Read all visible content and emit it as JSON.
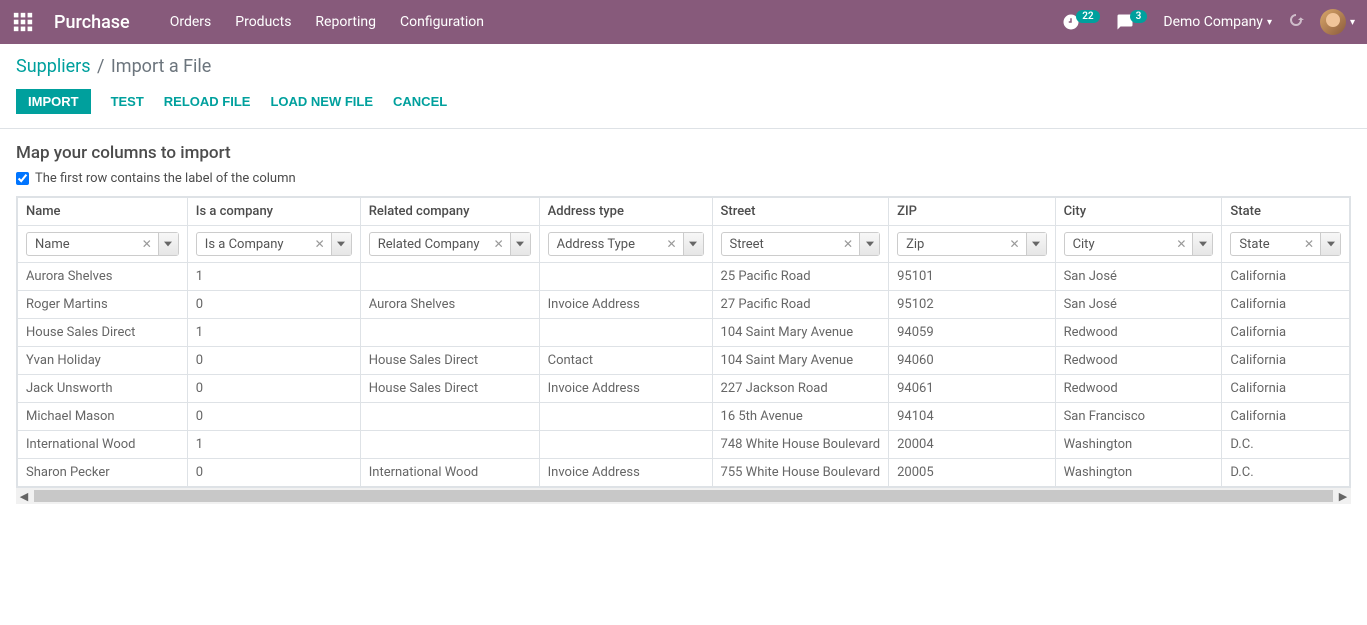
{
  "navbar": {
    "app_title": "Purchase",
    "menu": [
      "Orders",
      "Products",
      "Reporting",
      "Configuration"
    ],
    "activities_count": "22",
    "messages_count": "3",
    "company": "Demo Company"
  },
  "breadcrumb": {
    "root": "Suppliers",
    "current": "Import a File"
  },
  "actions": {
    "import": "IMPORT",
    "test": "TEST",
    "reload": "RELOAD FILE",
    "load_new": "LOAD NEW FILE",
    "cancel": "CANCEL"
  },
  "content": {
    "heading": "Map your columns to import",
    "first_row_label": "The first row contains the label of the column"
  },
  "columns": [
    {
      "header": "Name",
      "field": "Name"
    },
    {
      "header": "Is a company",
      "field": "Is a Company"
    },
    {
      "header": "Related company",
      "field": "Related Company"
    },
    {
      "header": "Address type",
      "field": "Address Type"
    },
    {
      "header": "Street",
      "field": "Street"
    },
    {
      "header": "ZIP",
      "field": "Zip"
    },
    {
      "header": "City",
      "field": "City"
    },
    {
      "header": "State",
      "field": "State"
    }
  ],
  "rows": [
    {
      "name": "Aurora Shelves",
      "is_company": "1",
      "related": "",
      "addr_type": "",
      "street": "25 Pacific Road",
      "zip": "95101",
      "city": "San José",
      "state": "California"
    },
    {
      "name": "Roger Martins",
      "is_company": "0",
      "related": "Aurora Shelves",
      "addr_type": "Invoice Address",
      "street": "27 Pacific Road",
      "zip": "95102",
      "city": "San José",
      "state": "California"
    },
    {
      "name": "House Sales Direct",
      "is_company": "1",
      "related": "",
      "addr_type": "",
      "street": "104 Saint Mary Avenue",
      "zip": "94059",
      "city": "Redwood",
      "state": "California"
    },
    {
      "name": "Yvan Holiday",
      "is_company": "0",
      "related": "House Sales Direct",
      "addr_type": "Contact",
      "street": "104 Saint Mary Avenue",
      "zip": "94060",
      "city": "Redwood",
      "state": "California"
    },
    {
      "name": "Jack Unsworth",
      "is_company": "0",
      "related": "House Sales Direct",
      "addr_type": "Invoice Address",
      "street": "227 Jackson Road",
      "zip": "94061",
      "city": "Redwood",
      "state": "California"
    },
    {
      "name": "Michael Mason",
      "is_company": "0",
      "related": "",
      "addr_type": "",
      "street": "16 5th Avenue",
      "zip": "94104",
      "city": "San Francisco",
      "state": "California"
    },
    {
      "name": "International Wood",
      "is_company": "1",
      "related": "",
      "addr_type": "",
      "street": "748 White House Boulevard",
      "zip": "20004",
      "city": "Washington",
      "state": "D.C."
    },
    {
      "name": "Sharon Pecker",
      "is_company": "0",
      "related": "International Wood",
      "addr_type": "Invoice Address",
      "street": "755 White House Boulevard",
      "zip": "20005",
      "city": "Washington",
      "state": "D.C."
    }
  ]
}
